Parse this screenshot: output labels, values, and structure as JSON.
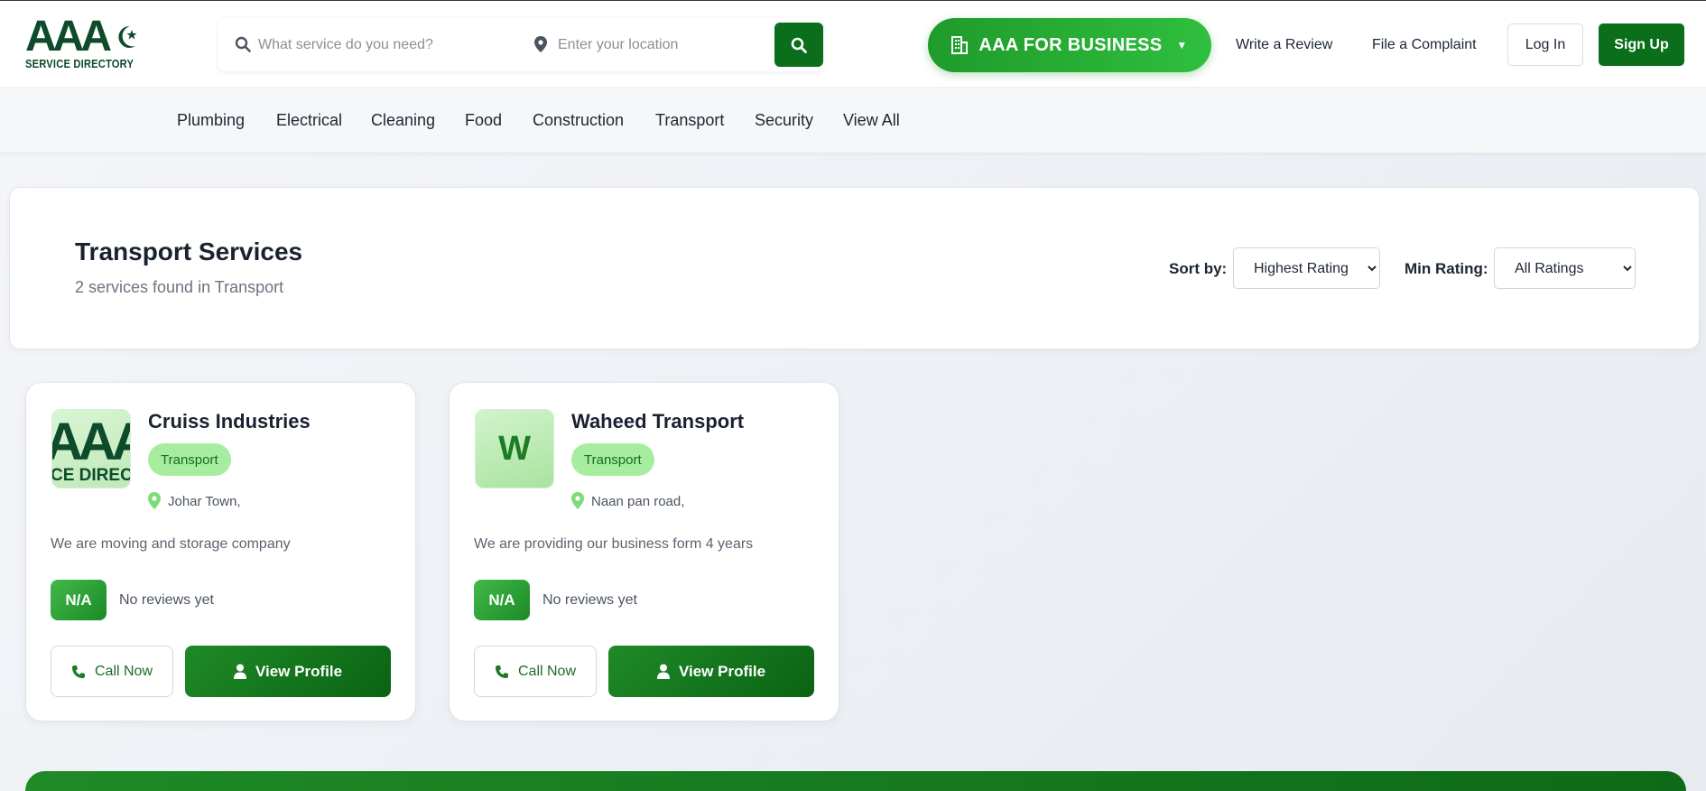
{
  "header": {
    "logo": {
      "mark": "AAA",
      "sub": "SERVICE DIRECTORY"
    },
    "search": {
      "service_placeholder": "What service do you need?",
      "location_placeholder": "Enter your location"
    },
    "business_button": "AAA FOR BUSINESS",
    "links": [
      "Write a Review",
      "File a Complaint"
    ],
    "login": "Log In",
    "signup": "Sign Up"
  },
  "categories": [
    "Plumbing",
    "Electrical",
    "Cleaning",
    "Food",
    "Construction",
    "Transport",
    "Security",
    "View All"
  ],
  "results": {
    "title": "Transport Services",
    "count_text": "2 services found in Transport",
    "sort_label": "Sort by:",
    "sort_value": "Highest Rating",
    "min_rating_label": "Min Rating:",
    "min_rating_value": "All Ratings"
  },
  "services": [
    {
      "name": "Cruiss Industries",
      "thumb_text": "AAA",
      "thumb_subtext": "CE DIRECT",
      "category": "Transport",
      "location": "Johar Town,",
      "description": "We are moving and storage company",
      "rating": "N/A",
      "reviews": "No reviews yet",
      "call": "Call Now",
      "view": "View Profile"
    },
    {
      "name": "Waheed Transport",
      "thumb_text": "W",
      "category": "Transport",
      "location": "Naan pan road,",
      "description": "We are providing our business form 4 years",
      "rating": "N/A",
      "reviews": "No reviews yet",
      "call": "Call Now",
      "view": "View Profile"
    }
  ],
  "colors": {
    "brand_dark": "#0b6e1a",
    "brand_light": "#2fbf3e",
    "tag_bg": "#a6eda0"
  }
}
